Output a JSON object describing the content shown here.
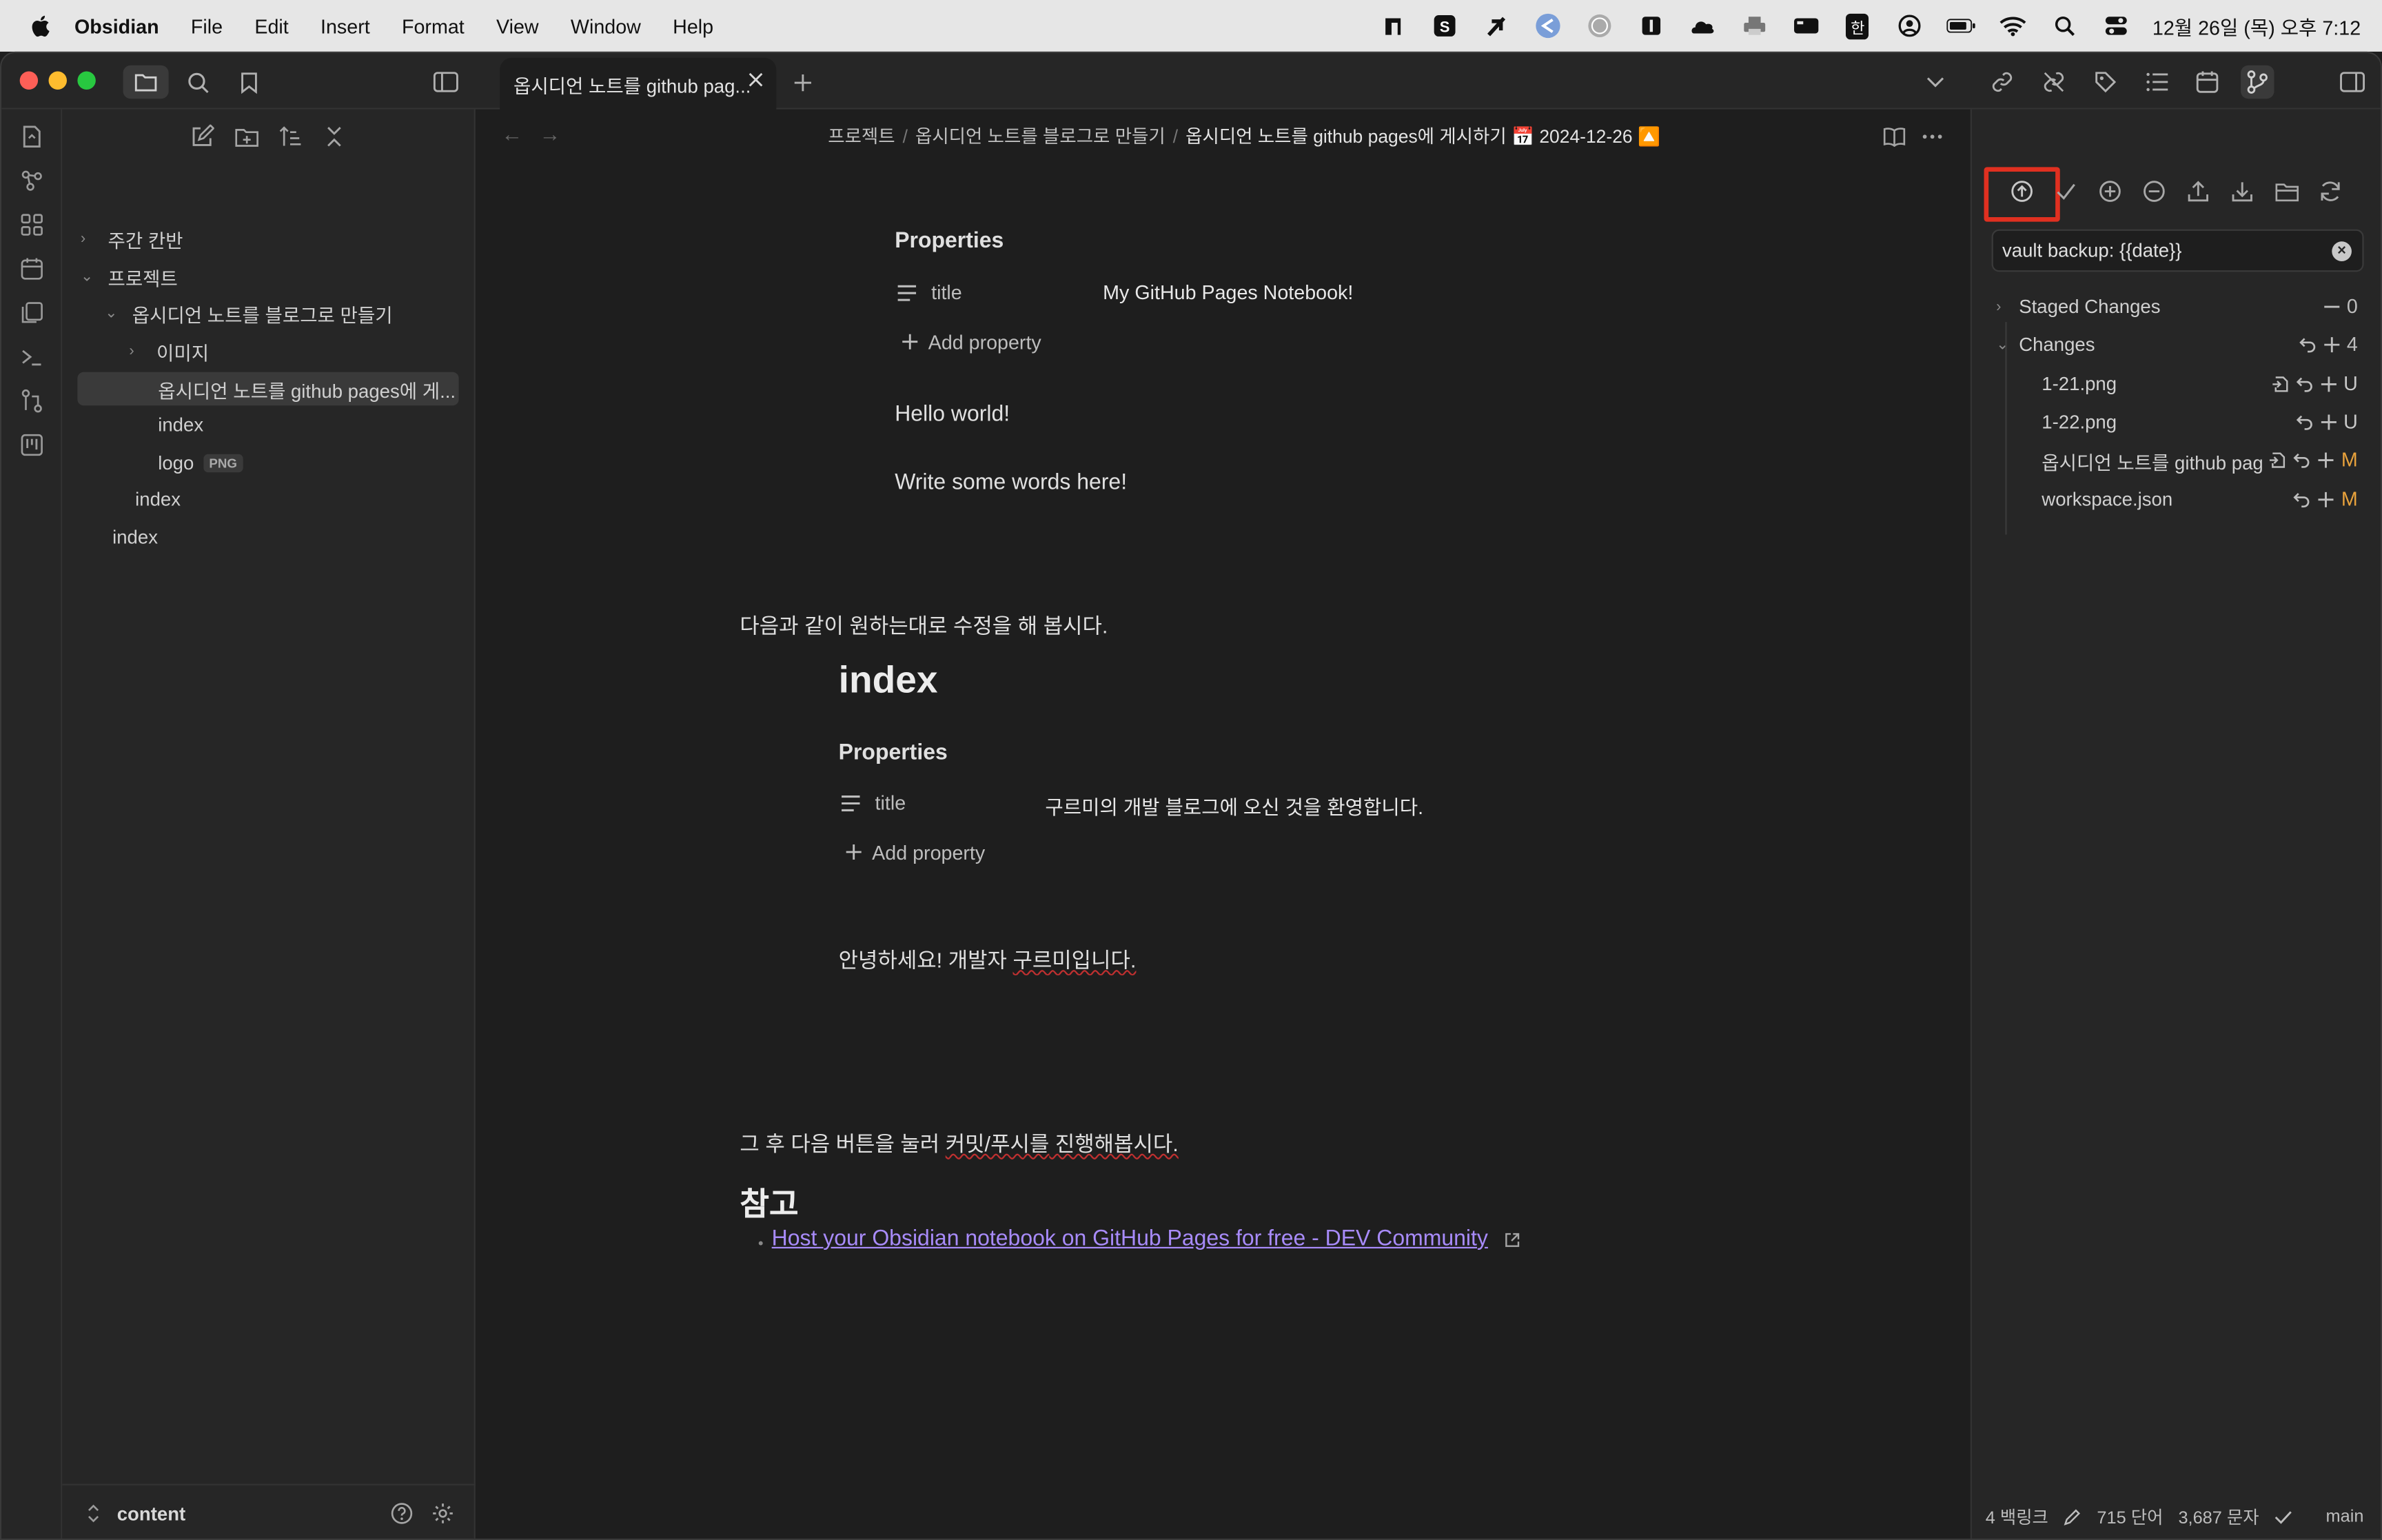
{
  "menubar": {
    "app_name": "Obsidian",
    "items": [
      "File",
      "Edit",
      "Insert",
      "Format",
      "View",
      "Window",
      "Help"
    ],
    "tray_icons": [
      "notion-icon",
      "s-app-icon",
      "feather-icon",
      "telegram-icon",
      "globe-icon",
      "book-icon",
      "cloud-icon",
      "printer-icon",
      "battery-like-icon",
      "input-method-icon",
      "user-circle-icon",
      "battery-icon",
      "wifi-icon",
      "search-icon",
      "control-center-icon"
    ],
    "input_method": "한",
    "clock": "12월 26일 (목) 오후 7:12"
  },
  "window": {
    "tab_title": "옵시디언 노트를 github pag...",
    "breadcrumb": [
      "프로젝트",
      "옵시디언 노트를 블로그로 만들기",
      "옵시디언 노트를 github pages에 게시하기 📅 2024-12-26 🔼"
    ]
  },
  "sidebar": {
    "tree": [
      {
        "label": "주간 칸반",
        "type": "folder",
        "expanded": false
      },
      {
        "label": "프로젝트",
        "type": "folder",
        "expanded": true
      },
      {
        "label": "옵시디언 노트를 블로그로 만들기",
        "type": "folder",
        "expanded": true
      },
      {
        "label": "이미지",
        "type": "folder",
        "expanded": false
      },
      {
        "label": "옵시디언 노트를 github pages에 게...",
        "type": "file",
        "selected": true
      },
      {
        "label": "index",
        "type": "file"
      },
      {
        "label": "logo",
        "type": "file",
        "badge": "PNG"
      },
      {
        "label": "index",
        "type": "file"
      },
      {
        "label": "index",
        "type": "file"
      }
    ],
    "vault_name": "content"
  },
  "editor": {
    "block1": {
      "properties_heading": "Properties",
      "prop_key": "title",
      "prop_value": "My GitHub Pages Notebook!",
      "add_property": "Add property",
      "line1": "Hello world!",
      "line2": "Write some words here!"
    },
    "para1": "다음과 같이 원하는대로 수정을 해 봅시다.",
    "block2": {
      "heading": "index",
      "properties_heading": "Properties",
      "prop_key": "title",
      "prop_value": "구르미의 개발 블로그에 오신 것을 환영합니다.",
      "add_property": "Add property",
      "greeting_pre": "안녕하세요! 개발자 ",
      "greeting_name": "구르미입니다."
    },
    "para2_pre": "그 후 다음 버튼을 눌러 ",
    "para2_mid": "커밋/푸시를",
    "para2_post": " 진행해봅시다.",
    "ref_heading": "참고",
    "ref_link": "Host your Obsidian notebook on GitHub Pages for free - DEV Community"
  },
  "git_panel": {
    "commit_message": "vault backup: {{date}}",
    "staged": {
      "label": "Staged Changes",
      "count": "0"
    },
    "changes": {
      "label": "Changes",
      "count": "4"
    },
    "files": [
      {
        "name": "1-21.png",
        "status": "U"
      },
      {
        "name": "1-22.png",
        "status": "U"
      },
      {
        "name": "옵시디언 노트를 github pag...",
        "status": "M"
      },
      {
        "name": "workspace.json",
        "status": "M"
      }
    ],
    "colors": {
      "modified": "#e8a23c",
      "highlight": "#e03020"
    }
  },
  "statusbar": {
    "backlinks": "4 백링크",
    "words": "715 단어",
    "chars": "3,687 문자",
    "branch": "main"
  }
}
